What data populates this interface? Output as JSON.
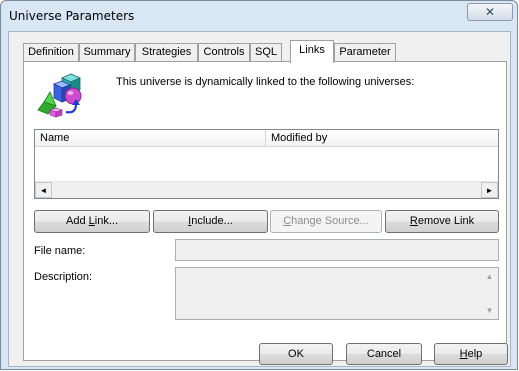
{
  "window": {
    "title": "Universe Parameters",
    "close_glyph": "✕"
  },
  "tabs": [
    {
      "label": "Definition"
    },
    {
      "label": "Summary"
    },
    {
      "label": "Strategies"
    },
    {
      "label": "Controls"
    },
    {
      "label": "SQL"
    },
    {
      "label": "Links",
      "active": true
    },
    {
      "label": "Parameter"
    }
  ],
  "links_panel": {
    "intro": "This universe is dynamically linked to the following universes:",
    "icon": "universe-link-icon",
    "list": {
      "columns": [
        "Name",
        "Modified by"
      ],
      "rows": [],
      "scroll_left_glyph": "◄",
      "scroll_right_glyph": "►"
    },
    "buttons": {
      "add_link": {
        "pre": "Add ",
        "key": "L",
        "post": "ink..."
      },
      "include": {
        "pre": "",
        "key": "I",
        "post": "nclude..."
      },
      "change_source": {
        "pre": "",
        "key": "C",
        "post": "hange Source..."
      },
      "remove_link": {
        "pre": "",
        "key": "R",
        "post": "emove Link"
      }
    },
    "file_name_label": "File name:",
    "file_name_value": "",
    "description_label": "Description:",
    "description_value": "",
    "scroll_up_glyph": "▲",
    "scroll_down_glyph": "▼"
  },
  "footer": {
    "ok": "OK",
    "cancel": "Cancel",
    "help": {
      "key": "H",
      "post": "elp"
    }
  }
}
